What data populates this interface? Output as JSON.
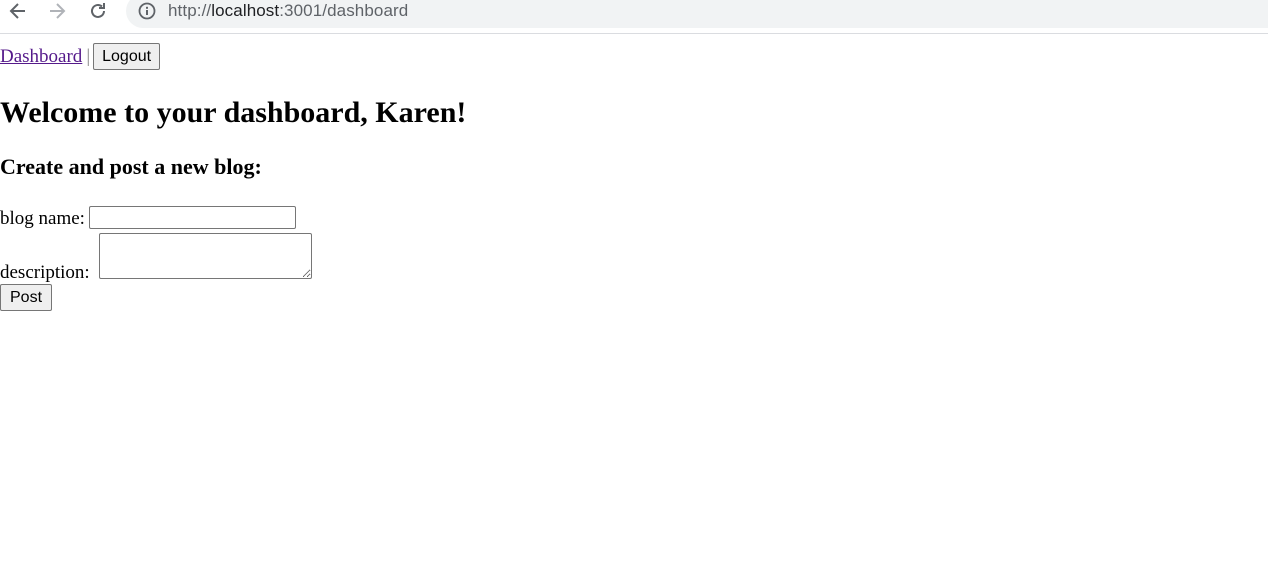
{
  "browser": {
    "url_prefix": "http://",
    "url_host": "localhost",
    "url_rest": ":3001/dashboard"
  },
  "nav": {
    "dashboard_link": "Dashboard",
    "separator": "|",
    "logout_label": "Logout"
  },
  "main": {
    "title": "Welcome to your dashboard, Karen!",
    "subtitle": "Create and post a new blog:"
  },
  "form": {
    "blog_name_label": "blog name:",
    "blog_name_value": "",
    "description_label": "description:",
    "description_value": "",
    "post_label": "Post"
  },
  "colors": {
    "link_visited": "#551a8b",
    "omnibox_bg": "#f1f3f4"
  }
}
